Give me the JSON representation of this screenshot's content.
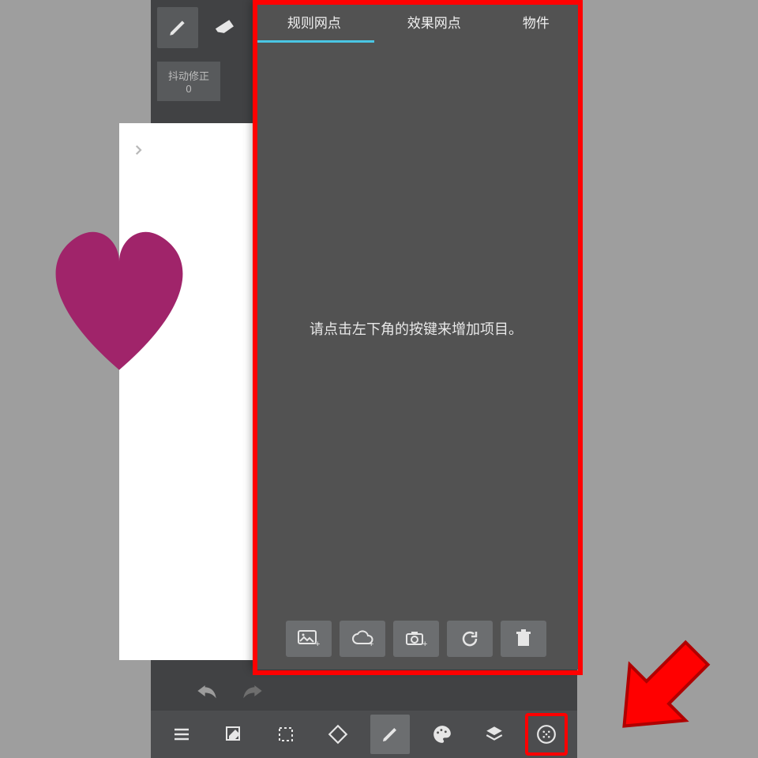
{
  "stabilization": {
    "label": "抖动修正",
    "value": "0"
  },
  "panel": {
    "tabs": [
      "规则网点",
      "效果网点",
      "物件"
    ],
    "empty_message": "请点击左下角的按键来增加项目。"
  },
  "icons": {
    "pencil": "pencil-icon",
    "eraser": "eraser-icon",
    "chevron": "chevron-right-icon",
    "undo": "undo-icon",
    "redo": "redo-icon",
    "menu": "menu-icon",
    "edit": "edit-icon",
    "select": "select-icon",
    "rotate": "rotate-icon",
    "brush": "brush-icon",
    "palette": "palette-icon",
    "layers": "layers-icon",
    "screentone": "screentone-icon",
    "image_add": "image-add-icon",
    "cloud_add": "cloud-add-icon",
    "camera_add": "camera-add-icon",
    "refresh": "refresh-icon",
    "trash": "trash-icon"
  }
}
